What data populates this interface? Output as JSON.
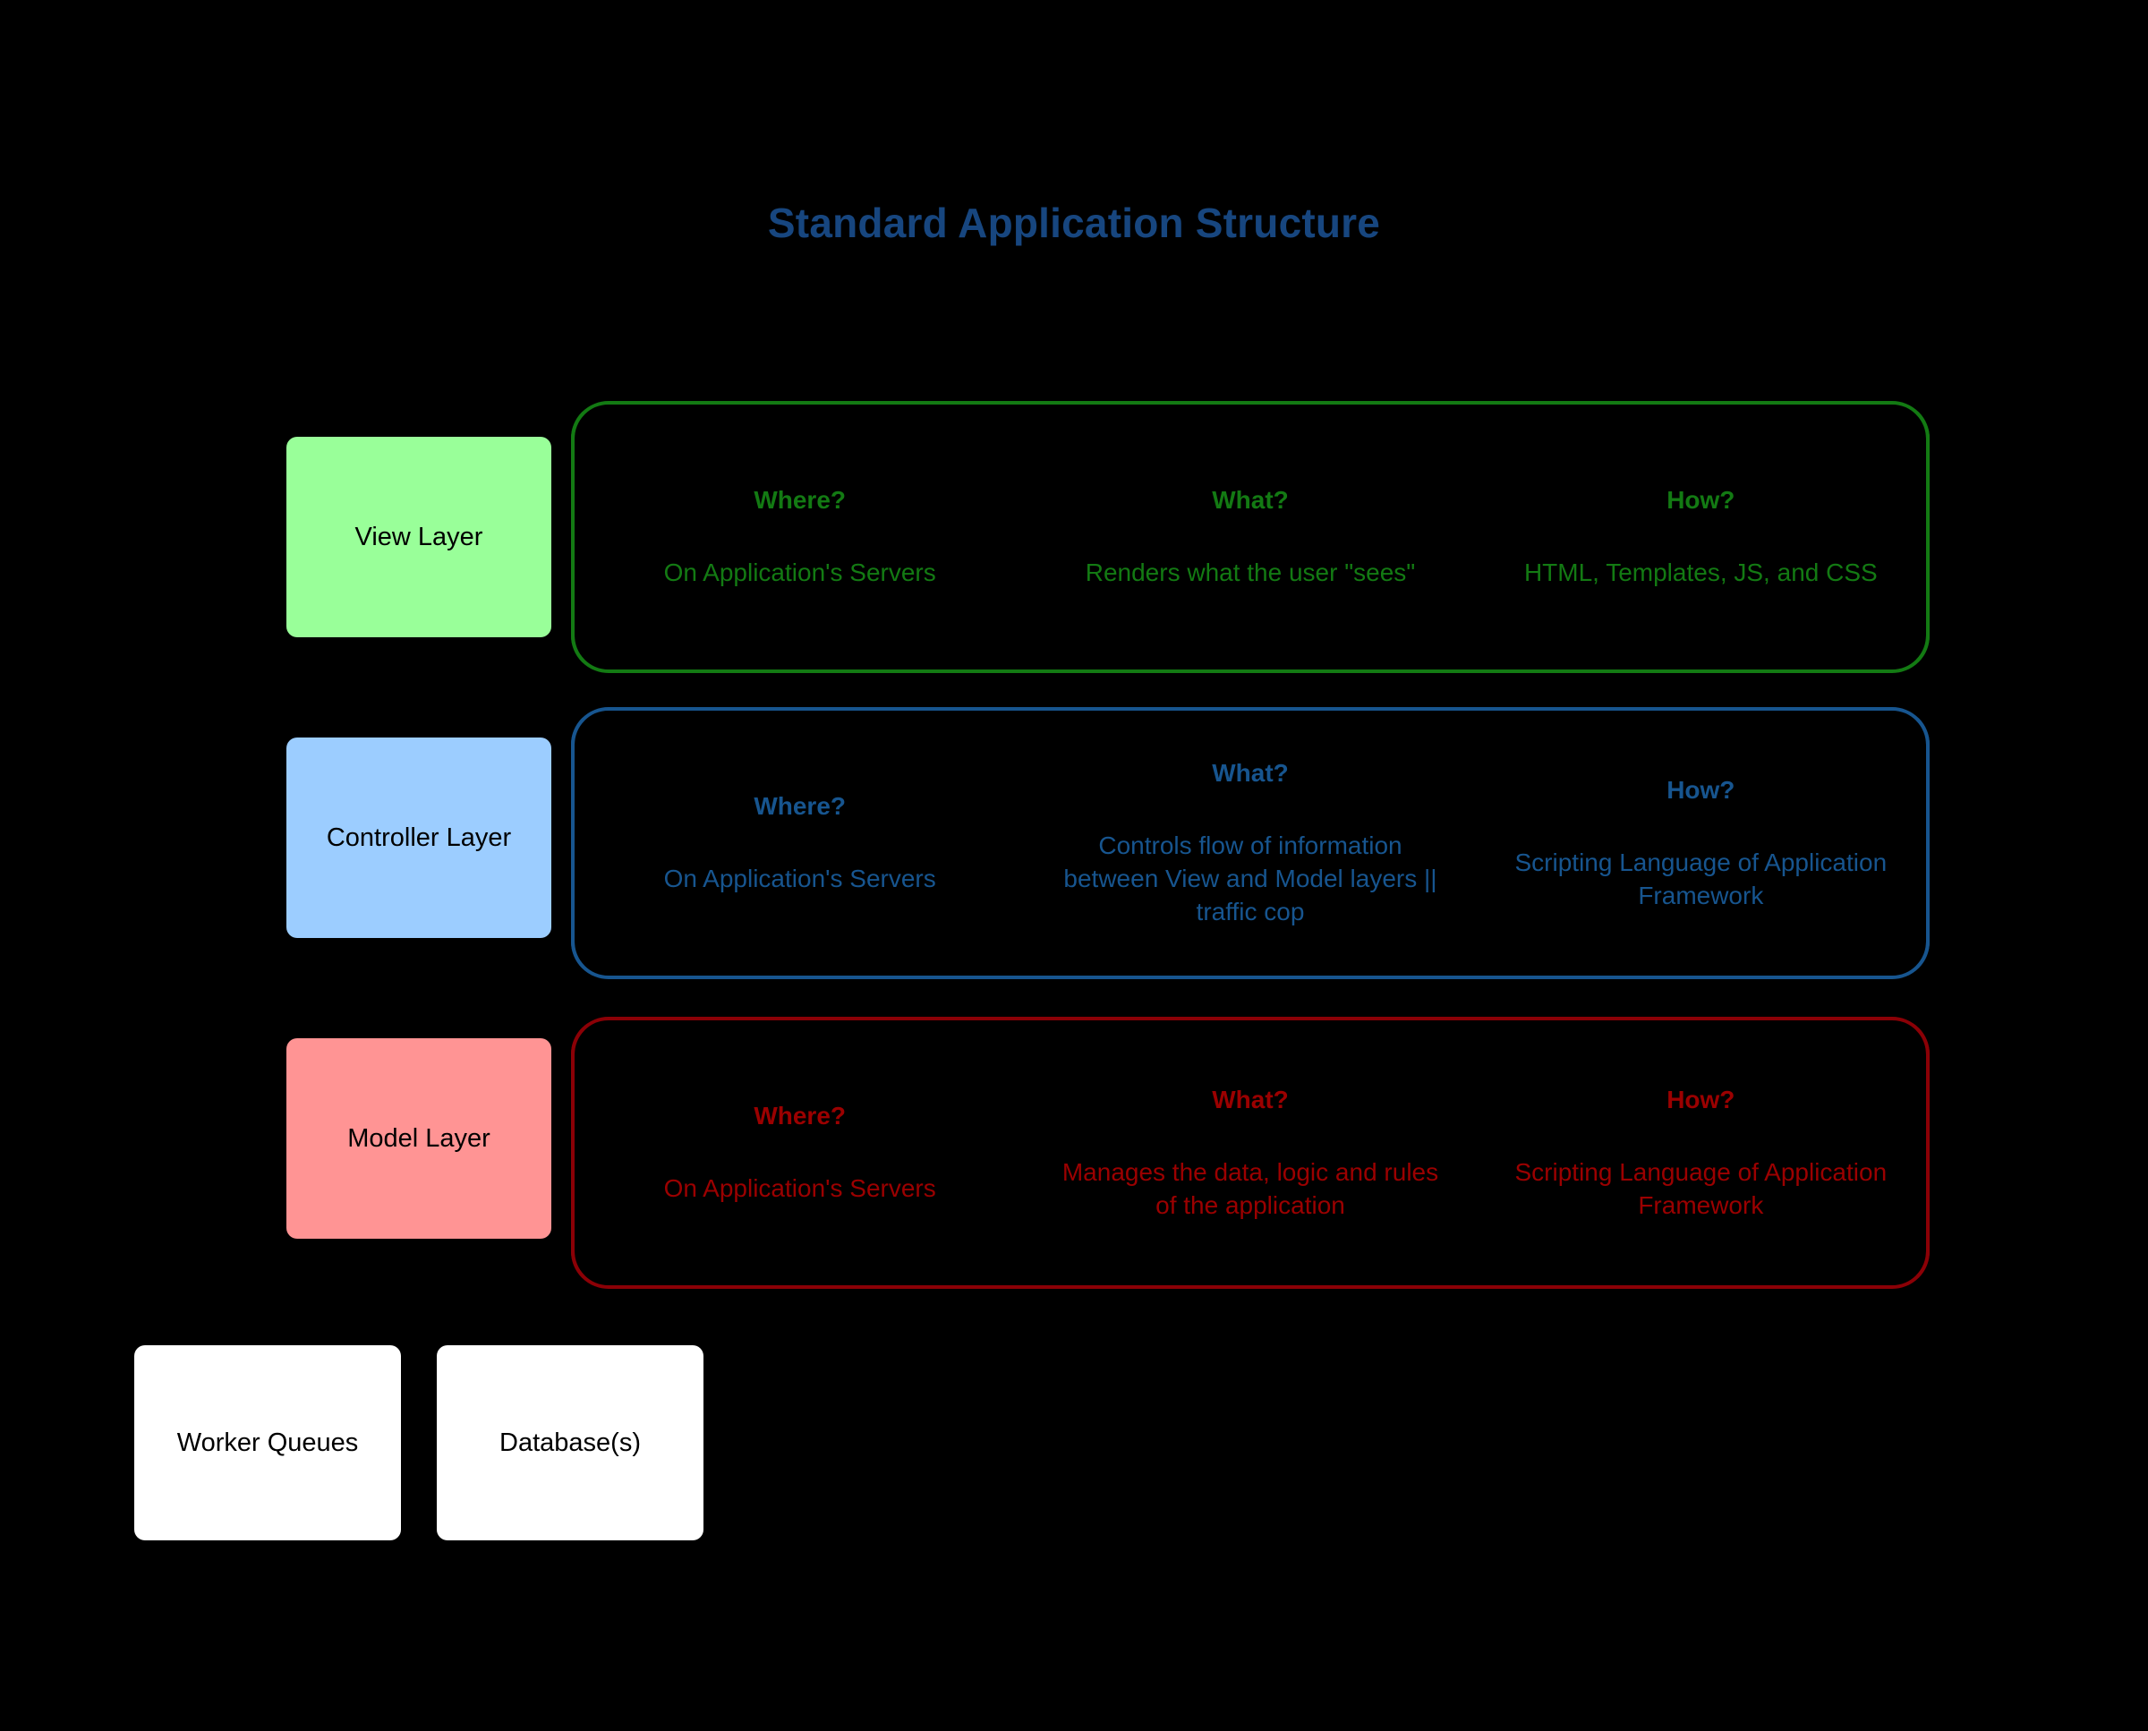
{
  "title": "Standard Application Structure",
  "colors": {
    "background": "#000000",
    "title": "#17467f",
    "view_accent": "#137a13",
    "view_fill": "#99ff99",
    "controller_accent": "#17558f",
    "controller_fill": "#9ccdff",
    "model_accent": "#9b0000",
    "model_fill": "#ff9494",
    "resource_fill": "#ffffff"
  },
  "layers": [
    {
      "id": "view",
      "name": "View Layer",
      "columns": [
        {
          "heading": "Where?",
          "body": "On Application's Servers"
        },
        {
          "heading": "What?",
          "body": "Renders what the user \"sees\""
        },
        {
          "heading": "How?",
          "body": "HTML, Templates, JS, and CSS"
        }
      ]
    },
    {
      "id": "controller",
      "name": "Controller Layer",
      "columns": [
        {
          "heading": "Where?",
          "body": "On Application's Servers"
        },
        {
          "heading": "What?",
          "body": "Controls flow of information between View and Model layers || traffic cop"
        },
        {
          "heading": "How?",
          "body": "Scripting Language of Application Framework"
        }
      ]
    },
    {
      "id": "model",
      "name": "Model Layer",
      "columns": [
        {
          "heading": "Where?",
          "body": "On Application's Servers"
        },
        {
          "heading": "What?",
          "body": "Manages the data, logic and rules of the application"
        },
        {
          "heading": "How?",
          "body": "Scripting Language of Application Framework"
        }
      ]
    }
  ],
  "resources": [
    {
      "id": "worker-queues",
      "label": "Worker Queues"
    },
    {
      "id": "databases",
      "label": "Database(s)"
    }
  ]
}
